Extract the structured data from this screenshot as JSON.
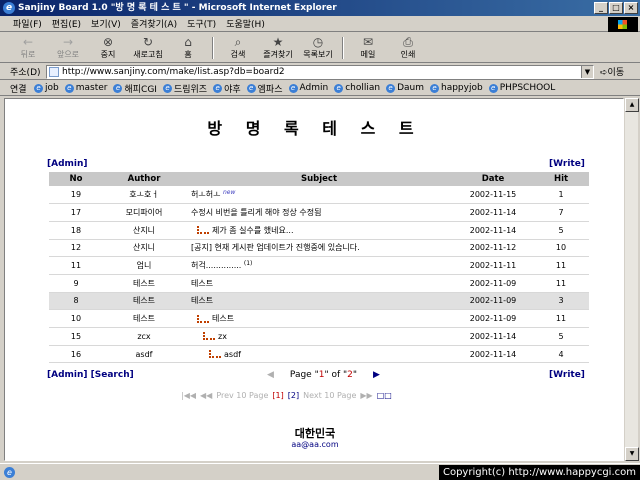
{
  "window": {
    "title": "Sanjiny Board 1.0 \"방 명 록 테 스 트 \" - Microsoft Internet Explorer",
    "buttons": [
      "_",
      "□",
      "×"
    ]
  },
  "menu": [
    "파일(F)",
    "편집(E)",
    "보기(V)",
    "즐겨찾기(A)",
    "도구(T)",
    "도움말(H)"
  ],
  "toolbar": [
    {
      "label": "뒤로",
      "icon": "back-icon",
      "glyph": "←",
      "disabled": true
    },
    {
      "label": "앞으로",
      "icon": "forward-icon",
      "glyph": "→",
      "disabled": true
    },
    {
      "label": "중지",
      "icon": "stop-icon",
      "glyph": "⊗",
      "disabled": false
    },
    {
      "label": "새로고침",
      "icon": "refresh-icon",
      "glyph": "↻",
      "disabled": false
    },
    {
      "label": "홈",
      "icon": "home-icon",
      "glyph": "⌂",
      "disabled": false
    },
    {
      "label": "검색",
      "icon": "search-icon",
      "glyph": "⌕",
      "disabled": false
    },
    {
      "label": "즐겨찾기",
      "icon": "favorites-icon",
      "glyph": "★",
      "disabled": false
    },
    {
      "label": "목록보기",
      "icon": "history-icon",
      "glyph": "◷",
      "disabled": false
    },
    {
      "label": "메일",
      "icon": "mail-icon",
      "glyph": "✉",
      "disabled": false
    },
    {
      "label": "인쇄",
      "icon": "print-icon",
      "glyph": "⎙",
      "disabled": false
    }
  ],
  "address": {
    "label": "주소(D)",
    "url": "http://www.sanjiny.com/make/list.asp?db=board2",
    "go": "이동"
  },
  "links": {
    "label": "연결",
    "items": [
      "job",
      "master",
      "해피CGI",
      "드림위즈",
      "야후",
      "엠파스",
      "Admin",
      "chollian",
      "Daum",
      "happyjob",
      "PHPSCHOOL"
    ]
  },
  "board": {
    "title": "방 명 록 테 스 트",
    "admin_link": "[Admin]",
    "write_link": "[Write]",
    "columns": {
      "no": "No",
      "author": "Author",
      "subject": "Subject",
      "date": "Date",
      "hit": "Hit"
    },
    "rows": [
      {
        "no": "19",
        "author": "호ㅗ호ㅓ",
        "subject": "허ㅗ허ㅗ",
        "badge": "new",
        "comments": "",
        "date": "2002-11-15",
        "hit": "1",
        "depth": 0,
        "highlight": false
      },
      {
        "no": "17",
        "author": "모디파이어",
        "subject": "수정시 비번을 틀리게 해야 정상 수정됨",
        "badge": "",
        "comments": "",
        "date": "2002-11-14",
        "hit": "7",
        "depth": 0,
        "highlight": false
      },
      {
        "no": "18",
        "author": "산지니",
        "subject": "제가 좀 실수를 했네요...",
        "badge": "",
        "comments": "",
        "date": "2002-11-14",
        "hit": "5",
        "depth": 1,
        "highlight": false
      },
      {
        "no": "12",
        "author": "산지니",
        "subject": "[공지] 현재 게시판 업데이트가 진행중에 있습니다.",
        "badge": "",
        "comments": "",
        "date": "2002-11-12",
        "hit": "10",
        "depth": 0,
        "highlight": false
      },
      {
        "no": "11",
        "author": "엄니",
        "subject": "허걱..............",
        "badge": "",
        "comments": "(1)",
        "date": "2002-11-11",
        "hit": "11",
        "depth": 0,
        "highlight": false
      },
      {
        "no": "9",
        "author": "테스트",
        "subject": "테스트",
        "badge": "",
        "comments": "",
        "date": "2002-11-09",
        "hit": "11",
        "depth": 0,
        "highlight": false
      },
      {
        "no": "8",
        "author": "테스트",
        "subject": "테스트",
        "badge": "",
        "comments": "",
        "date": "2002-11-09",
        "hit": "3",
        "depth": 0,
        "highlight": true
      },
      {
        "no": "10",
        "author": "테스트",
        "subject": "테스트",
        "badge": "",
        "comments": "",
        "date": "2002-11-09",
        "hit": "11",
        "depth": 1,
        "highlight": false
      },
      {
        "no": "15",
        "author": "zcx",
        "subject": "zx",
        "badge": "",
        "comments": "",
        "date": "2002-11-14",
        "hit": "5",
        "depth": 2,
        "highlight": false
      },
      {
        "no": "16",
        "author": "asdf",
        "subject": "asdf",
        "badge": "",
        "comments": "",
        "date": "2002-11-14",
        "hit": "4",
        "depth": 3,
        "highlight": false
      }
    ],
    "footer_admin": "[Admin]",
    "footer_search": "[Search]",
    "footer_write": "[Write]",
    "page_prefix": "Page \"",
    "page_current": "1",
    "page_of": "\" of \"",
    "page_total": "2",
    "page_suffix": "\"",
    "pagination": {
      "first": "|◀◀",
      "prev10_arrow": "◀◀",
      "prev10": "Prev 10 Page",
      "current": "[1]",
      "other": "[2]",
      "next10": "Next 10 Page",
      "next10_arrow": "▶▶",
      "last": "□□"
    },
    "brand": "대한민국",
    "email": "aa@aa.com"
  },
  "status": {
    "copyright": "Copyright(c) http://www.happycgi.com"
  }
}
